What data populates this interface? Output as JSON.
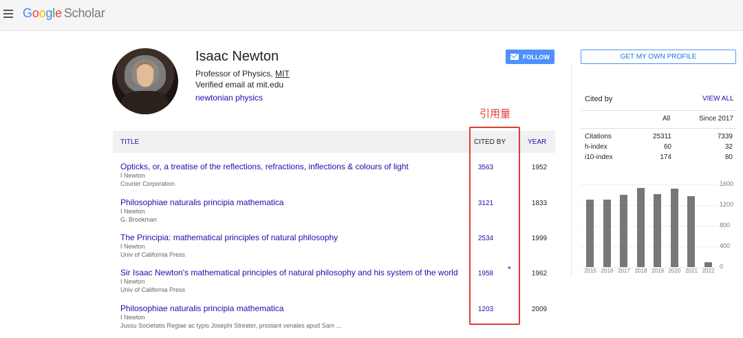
{
  "header": {
    "logo": {
      "G": "G",
      "o1": "o",
      "o2": "o",
      "g": "g",
      "l": "l",
      "e": "e",
      "scholar": "Scholar"
    },
    "menu_icon": "hamburger-menu-icon"
  },
  "profile": {
    "name": "Isaac Newton",
    "affiliation_prefix": "Professor of Physics, ",
    "affiliation_org": "MIT",
    "email": "Verified email at mit.edu",
    "interest": "newtonian physics",
    "follow_label": "FOLLOW"
  },
  "annotation": "引用量",
  "table": {
    "headers": {
      "title": "TITLE",
      "cited_by": "CITED BY",
      "year": "YEAR"
    },
    "rows": [
      {
        "title": "Opticks, or, a treatise of the reflections, refractions, inflections & colours of light",
        "author": "I Newton",
        "venue": "Courier Corporation",
        "cited_by": "3563",
        "star": "",
        "year": "1952"
      },
      {
        "title": "Philosophiae naturalis principia mathematica",
        "author": "I Newton",
        "venue": "G. Brookman",
        "cited_by": "3121",
        "star": "",
        "year": "1833"
      },
      {
        "title": "The Principia: mathematical principles of natural philosophy",
        "author": "I Newton",
        "venue": "Univ of California Press",
        "cited_by": "2534",
        "star": "",
        "year": "1999"
      },
      {
        "title": "Sir Isaac Newton's mathematical principles of natural philosophy and his system of the world",
        "author": "I Newton",
        "venue": "Univ of California Press",
        "cited_by": "1958",
        "star": "*",
        "year": "1962"
      },
      {
        "title": "Philosophiae naturalis principia mathematica",
        "author": "I Newton",
        "venue": "Jussu Societatis Regiae ac typis Josephi Streater, prostant venales apud Sam ...",
        "cited_by": "1203",
        "star": "",
        "year": "2009"
      }
    ]
  },
  "sidebar": {
    "get_profile_label": "GET MY OWN PROFILE",
    "cited_by_label": "Cited by",
    "view_all_label": "VIEW ALL",
    "col_all": "All",
    "col_since": "Since 2017",
    "stats": [
      {
        "label": "Citations",
        "all": "25311",
        "since": "7339"
      },
      {
        "label": "h-index",
        "all": "60",
        "since": "32"
      },
      {
        "label": "i10-index",
        "all": "174",
        "since": "80"
      }
    ]
  },
  "chart_data": {
    "type": "bar",
    "categories": [
      "2015",
      "2016",
      "2017",
      "2018",
      "2019",
      "2020",
      "2021",
      "2022"
    ],
    "values": [
      1310,
      1310,
      1400,
      1540,
      1420,
      1520,
      1380,
      100
    ],
    "ylim": [
      0,
      1600
    ],
    "yticks": [
      "1600",
      "1200",
      "800",
      "400",
      "0"
    ],
    "bar_color": "#777777"
  },
  "colors": {
    "link": "#1a0dab",
    "accent": "#4d90fe",
    "annotation": "#e53935"
  }
}
